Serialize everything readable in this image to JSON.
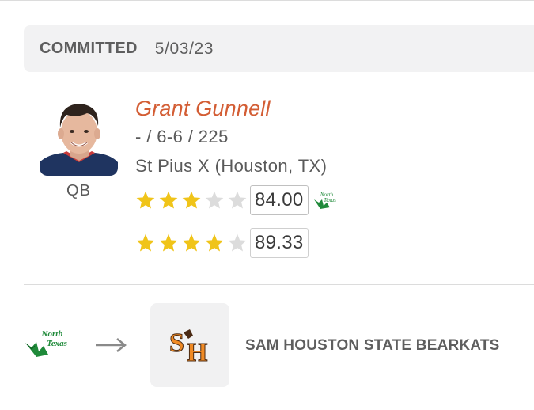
{
  "commitment": {
    "status_label": "COMMITTED",
    "date": "5/03/23"
  },
  "player": {
    "name": "Grant Gunnell",
    "measurables": "- / 6-6 / 225",
    "school": "St Pius X (Houston, TX)",
    "position": "QB",
    "ratings": [
      {
        "stars_filled": 3,
        "stars_total": 5,
        "score": "84.00",
        "logo": "north-texas-logo"
      },
      {
        "stars_filled": 4,
        "stars_total": 5,
        "score": "89.33"
      }
    ]
  },
  "transfer": {
    "from_logo": "north-texas-logo",
    "from_logo_text": "NORTH TEXAS",
    "arrow": "arrow-right-icon",
    "to_logo": "sam-houston-sh-logo",
    "to_logo_text": "SH",
    "to_team": "SAM HOUSTON STATE BEARKATS"
  },
  "colors": {
    "name_accent": "#d35d34",
    "star_filled": "#f0c419",
    "star_empty": "#dcdcdc",
    "north_texas_green": "#1f8a3a",
    "sam_houston_orange": "#f08a24",
    "panel_bg": "#f2f2f3"
  }
}
